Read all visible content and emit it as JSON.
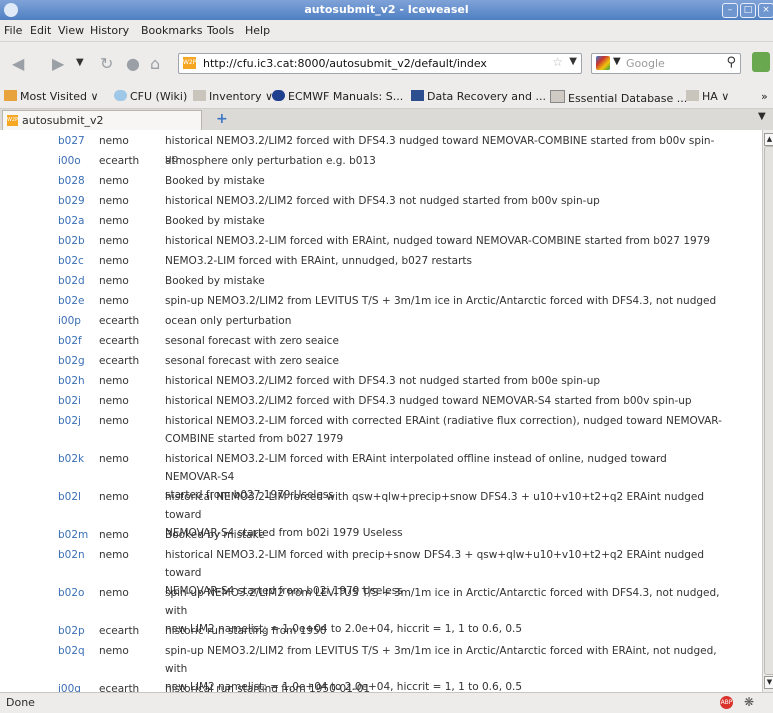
{
  "window": {
    "title": "autosubmit_v2 - Iceweasel"
  },
  "menu": [
    "File",
    "Edit",
    "View",
    "History",
    "Bookmarks",
    "Tools",
    "Help"
  ],
  "nav": {
    "url": "http://cfu.ic3.cat:8000/autosubmit_v2/default/index",
    "search_placeholder": "Google"
  },
  "bookmarks": [
    {
      "label": "Most Visited",
      "caret": "∨"
    },
    {
      "label": "CFU (Wiki)"
    },
    {
      "label": "Inventory",
      "caret": "∨"
    },
    {
      "label": "ECMWF Manuals: S..."
    },
    {
      "label": "Data Recovery and ..."
    },
    {
      "label": "Essential Database ..."
    },
    {
      "label": "HA",
      "caret": "∨"
    },
    {
      "label": "»"
    }
  ],
  "tab": {
    "label": "autosubmit_v2",
    "new_tab": "+"
  },
  "rows": [
    {
      "id": "b027",
      "model": "nemo",
      "lines": [
        "historical NEMO3.2/LIM2 forced with DFS4.3 nudged toward NEMOVAR-COMBINE started from b00v spin-up"
      ]
    },
    {
      "id": "i00o",
      "model": "ecearth",
      "lines": [
        "atmosphere only perturbation e.g. b013"
      ]
    },
    {
      "id": "b028",
      "model": "nemo",
      "lines": [
        "Booked by mistake"
      ]
    },
    {
      "id": "b029",
      "model": "nemo",
      "lines": [
        "historical NEMO3.2/LIM2 forced with DFS4.3 not nudged started from b00v spin-up"
      ]
    },
    {
      "id": "b02a",
      "model": "nemo",
      "lines": [
        "Booked by mistake"
      ]
    },
    {
      "id": "b02b",
      "model": "nemo",
      "lines": [
        "historical NEMO3.2-LIM forced with ERAint, nudged toward NEMOVAR-COMBINE started from b027 1979"
      ]
    },
    {
      "id": "b02c",
      "model": "nemo",
      "lines": [
        "NEMO3.2-LIM forced with ERAint, unnudged, b027 restarts"
      ]
    },
    {
      "id": "b02d",
      "model": "nemo",
      "lines": [
        "Booked by mistake"
      ]
    },
    {
      "id": "b02e",
      "model": "nemo",
      "lines": [
        "spin-up NEMO3.2/LIM2 from LEVITUS T/S + 3m/1m ice in Arctic/Antarctic forced with DFS4.3, not nudged"
      ]
    },
    {
      "id": "i00p",
      "model": "ecearth",
      "lines": [
        "ocean only perturbation"
      ]
    },
    {
      "id": "b02f",
      "model": "ecearth",
      "lines": [
        "sesonal forecast with zero seaice"
      ]
    },
    {
      "id": "b02g",
      "model": "ecearth",
      "lines": [
        "sesonal forecast with zero seaice"
      ]
    },
    {
      "id": "b02h",
      "model": "nemo",
      "lines": [
        "historical NEMO3.2/LIM2 forced with DFS4.3 not nudged started from b00e spin-up"
      ]
    },
    {
      "id": "b02i",
      "model": "nemo",
      "lines": [
        "historical NEMO3.2/LIM2 forced with DFS4.3 nudged toward NEMOVAR-S4 started from b00v spin-up"
      ]
    },
    {
      "id": "b02j",
      "model": "nemo",
      "lines": [
        "historical NEMO3.2-LIM forced with corrected ERAint (radiative flux correction), nudged toward NEMOVAR-",
        "COMBINE started from b027 1979"
      ]
    },
    {
      "id": "b02k",
      "model": "nemo",
      "lines": [
        "historical NEMO3.2-LIM forced with ERAint interpolated offline instead of online, nudged toward NEMOVAR-S4",
        "started from b027 1979 Useless"
      ]
    },
    {
      "id": "b02l",
      "model": "nemo",
      "lines": [
        "historical NEMO3.2-LIM forced with qsw+qlw+precip+snow DFS4.3 + u10+v10+t2+q2 ERAint nudged toward",
        "NEMOVAR-S4 started from b02i 1979 Useless"
      ]
    },
    {
      "id": "b02m",
      "model": "nemo",
      "lines": [
        "Booked by mistake"
      ]
    },
    {
      "id": "b02n",
      "model": "nemo",
      "lines": [
        "historical NEMO3.2-LIM forced with precip+snow DFS4.3 + qsw+qlw+u10+v10+t2+q2 ERAint nudged toward",
        "NEMOVAR-S4 started from b02i 1979 Useless"
      ]
    },
    {
      "id": "b02o",
      "model": "nemo",
      "lines": [
        "spin-up NEMO3.2/LIM2 from LEVITUS T/S + 3m/1m ice in Arctic/Antarctic forced with DFS4.3, not nudged, with",
        "new LIM2 namelist: = 1.0e+04 to 2.0e+04, hiccrit = 1, 1 to 0.6, 0.5"
      ]
    },
    {
      "id": "b02p",
      "model": "ecearth",
      "lines": [
        "historic run starting from 1950"
      ]
    },
    {
      "id": "b02q",
      "model": "nemo",
      "lines": [
        "spin-up NEMO3.2/LIM2 from LEVITUS T/S + 3m/1m ice in Arctic/Antarctic forced with ERAint, not nudged, with",
        "new LIM2 namelist: = 1.0e+04 to 2.0e+04, hiccrit = 1, 1 to 0.6, 0.5"
      ]
    },
    {
      "id": "i00q",
      "model": "ecearth",
      "lines": [
        "historical run starting from 1950-01-01"
      ]
    }
  ],
  "status": {
    "text": "Done",
    "abp": "ABP"
  }
}
